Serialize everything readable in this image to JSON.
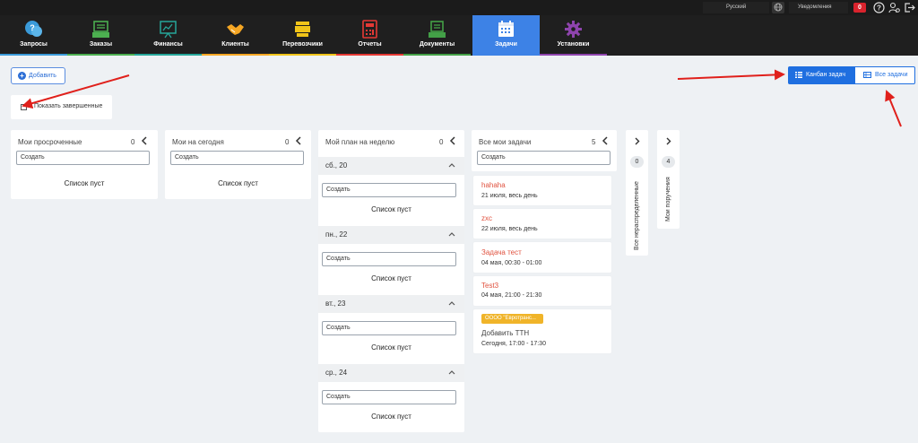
{
  "topbar": {
    "language": "Русский",
    "notifications_label": "Уведомления",
    "notifications_count": "0"
  },
  "nav": [
    {
      "label": "Запросы",
      "icon": "chat-bubbles-icon",
      "color": "#3a9ad9"
    },
    {
      "label": "Заказы",
      "icon": "inbox-tray-icon",
      "color": "#4caf50"
    },
    {
      "label": "Финансы",
      "icon": "presentation-chart-icon",
      "color": "#26a69a"
    },
    {
      "label": "Клиенты",
      "icon": "handshake-icon",
      "color": "#f5a623"
    },
    {
      "label": "Перевозчики",
      "icon": "truck-icon",
      "color": "#f0c419"
    },
    {
      "label": "Отчеты",
      "icon": "calculator-icon",
      "color": "#e53935"
    },
    {
      "label": "Документы",
      "icon": "document-tray-icon",
      "color": "#43a047"
    },
    {
      "label": "Задачи",
      "icon": "calendar-icon",
      "color": "#ffffff",
      "active": true
    },
    {
      "label": "Установки",
      "icon": "gear-icon",
      "color": "#8e44ad"
    }
  ],
  "toolbar": {
    "add_label": "Добавить",
    "show_completed_label": "Показать завершенные",
    "kanban_label": "Канбан задач",
    "all_tasks_label": "Все задачи"
  },
  "columns": {
    "overdue": {
      "title": "Мои просроченные",
      "count": "0",
      "create_placeholder": "Создать",
      "empty": "Список пуст"
    },
    "today": {
      "title": "Мои на сегодня",
      "count": "0",
      "create_placeholder": "Создать",
      "empty": "Список пуст"
    },
    "week": {
      "title": "Мой план на неделю",
      "count": "0",
      "days": [
        {
          "label": "сб., 20",
          "create_placeholder": "Создать",
          "empty": "Список пуст"
        },
        {
          "label": "пн., 22",
          "create_placeholder": "Создать",
          "empty": "Список пуст"
        },
        {
          "label": "вт., 23",
          "create_placeholder": "Создать",
          "empty": "Список пуст"
        },
        {
          "label": "ср., 24",
          "create_placeholder": "Создать",
          "empty": "Список пуст"
        }
      ]
    },
    "all": {
      "title": "Все мои задачи",
      "count": "5",
      "create_placeholder": "Создать",
      "tasks": [
        {
          "title": "hahaha",
          "time": "21 июля, весь день"
        },
        {
          "title": "zxc",
          "time": "22 июля, весь день"
        },
        {
          "title": "Задача тест",
          "time": "04 мая, 00:30 - 01:00"
        },
        {
          "title": "Test3",
          "time": "04 мая, 21:00 - 21:30"
        },
        {
          "tag": "ОООО \"Евротранс...",
          "title": "Добавить ТТН",
          "time": "Сегодня, 17:00 - 17:30"
        }
      ]
    },
    "unassigned": {
      "title": "Все нераспределенные",
      "count": "0"
    },
    "assignments": {
      "title": "Мои поручения",
      "count": "4"
    }
  }
}
